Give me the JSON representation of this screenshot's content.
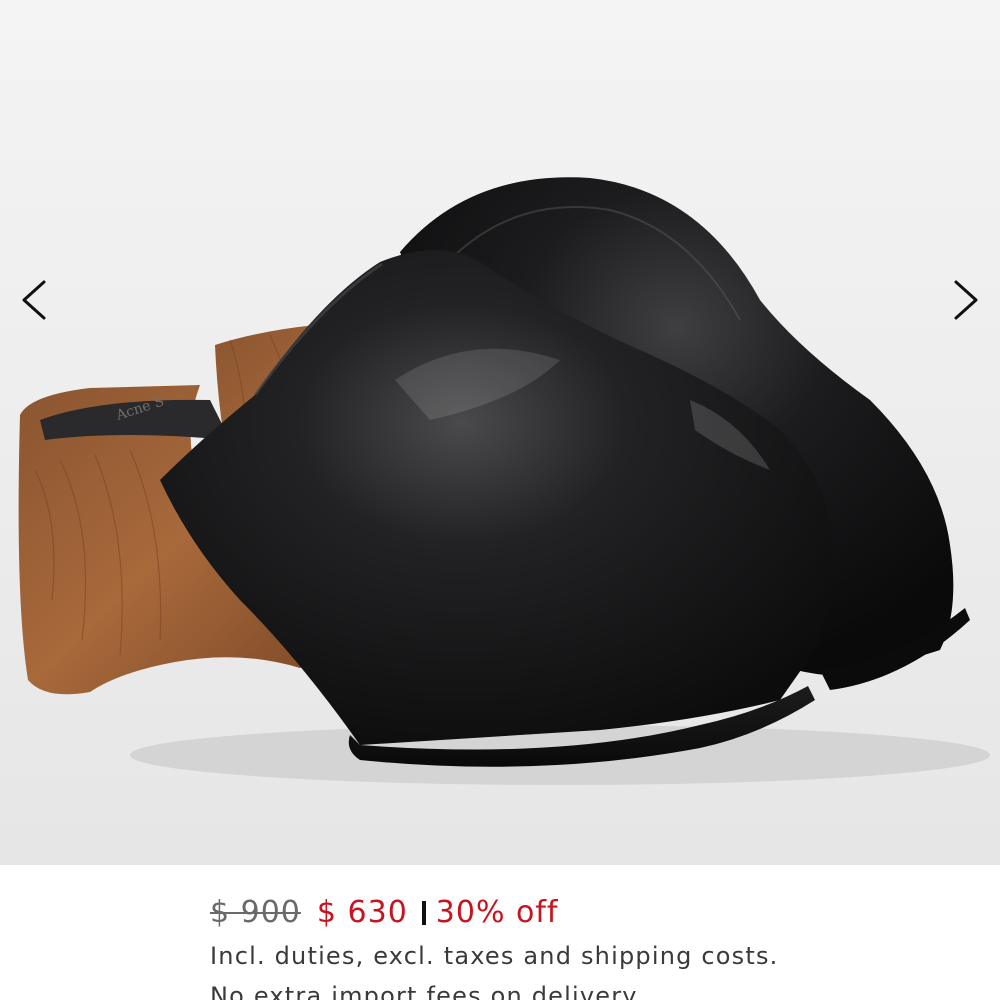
{
  "gallery": {
    "product": "black leather platform clogs with wooden heels",
    "prev_icon": "chevron-left-icon",
    "next_icon": "chevron-right-icon",
    "insole_brand_text": "Acne S"
  },
  "pricing": {
    "original_price": "$ 900",
    "sale_price": "$ 630",
    "separator": "I",
    "discount_label": "30% off",
    "sale_color": "#c8141e"
  },
  "notes": {
    "line1": "Incl. duties, excl. taxes and shipping costs.",
    "line2": "No extra import fees on delivery"
  }
}
